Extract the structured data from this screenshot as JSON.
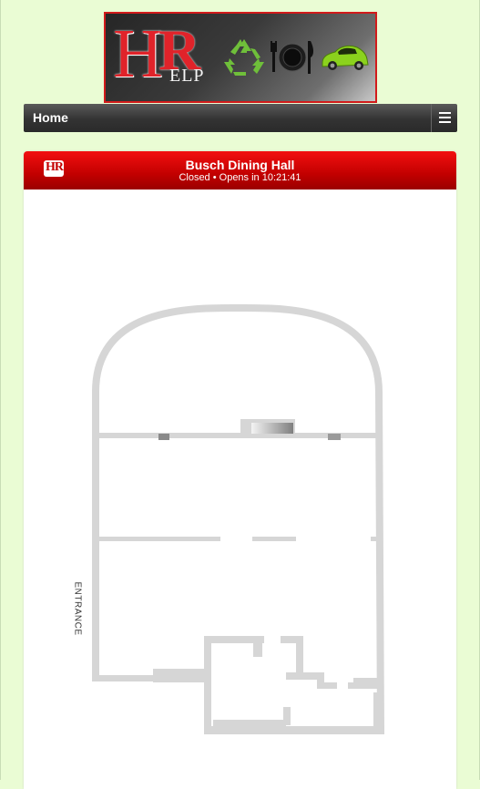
{
  "banner": {
    "logo_h": "H",
    "logo_r": "R",
    "logo_elp": "ELP",
    "icons": [
      "recycle-icon",
      "dining-plate-icon",
      "car-icon"
    ],
    "border_color": "#d21b1b"
  },
  "nav": {
    "home_label": "Home",
    "menu_icon": "hamburger-menu-icon"
  },
  "dining": {
    "name": "Busch Dining Hall",
    "status": "Closed • Opens in 10:21:41",
    "header_color": "#e00000"
  },
  "floorplan": {
    "entrance_label": "ENTRANCE",
    "wall_color": "#d6d6d6"
  }
}
